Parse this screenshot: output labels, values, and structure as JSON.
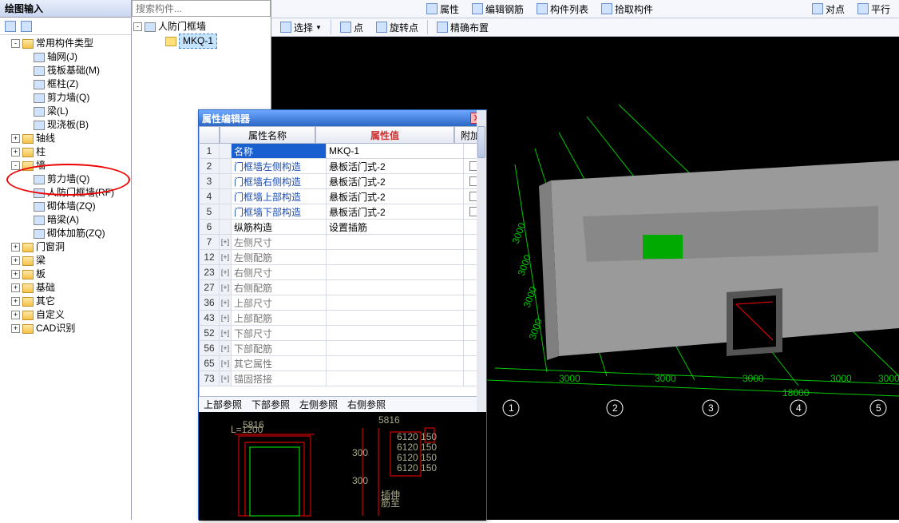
{
  "left_panel": {
    "title": "绘图输入",
    "tree": [
      {
        "level": 1,
        "exp": "-",
        "folder": true,
        "label": "常用构件类型"
      },
      {
        "level": 2,
        "icon": true,
        "label": "轴网(J)"
      },
      {
        "level": 2,
        "icon": true,
        "label": "筏板基础(M)"
      },
      {
        "level": 2,
        "icon": true,
        "label": "框柱(Z)"
      },
      {
        "level": 2,
        "icon": true,
        "label": "剪力墙(Q)"
      },
      {
        "level": 2,
        "icon": true,
        "label": "梁(L)"
      },
      {
        "level": 2,
        "icon": true,
        "label": "现浇板(B)"
      },
      {
        "level": 1,
        "exp": "+",
        "folder": true,
        "label": "轴线"
      },
      {
        "level": 1,
        "exp": "+",
        "folder": true,
        "label": "柱"
      },
      {
        "level": 1,
        "exp": "-",
        "folder": true,
        "label": "墙"
      },
      {
        "level": 2,
        "icon": true,
        "label": "剪力墙(Q)"
      },
      {
        "level": 2,
        "icon": true,
        "label": "人防门框墙(RF)"
      },
      {
        "level": 2,
        "icon": true,
        "label": "砌体墙(ZQ)"
      },
      {
        "level": 2,
        "icon": true,
        "label": "暗梁(A)"
      },
      {
        "level": 2,
        "icon": true,
        "label": "砌体加筋(ZQ)"
      },
      {
        "level": 1,
        "exp": "+",
        "folder": true,
        "label": "门窗洞"
      },
      {
        "level": 1,
        "exp": "+",
        "folder": true,
        "label": "梁"
      },
      {
        "level": 1,
        "exp": "+",
        "folder": true,
        "label": "板"
      },
      {
        "level": 1,
        "exp": "+",
        "folder": true,
        "label": "基础"
      },
      {
        "level": 1,
        "exp": "+",
        "folder": true,
        "label": "其它"
      },
      {
        "level": 1,
        "exp": "+",
        "folder": true,
        "label": "自定义"
      },
      {
        "level": 1,
        "exp": "+",
        "folder": true,
        "label": "CAD识别"
      }
    ]
  },
  "mid_panel": {
    "search_placeholder": "搜索构件...",
    "root_label": "人防门框墙",
    "item_label": "MKQ-1"
  },
  "toolbar": {
    "row1_items": [
      "属性",
      "编辑钢筋",
      "构件列表",
      "拾取构件"
    ],
    "row1_right": [
      "对点",
      "平行"
    ],
    "row2_select": "选择",
    "row2_point": "点",
    "row2_rotate": "旋转点",
    "row2_place": "精确布置"
  },
  "dialog": {
    "title": "属性编辑器",
    "col_name": "属性名称",
    "col_value": "属性值",
    "col_add": "附加",
    "rows": [
      {
        "n": "1",
        "ex": "",
        "name": "名称",
        "val": "MKQ-1",
        "chk": false,
        "sel": true,
        "blue": false
      },
      {
        "n": "2",
        "ex": "",
        "name": "门框墙左侧构造",
        "val": "悬板活门式-2",
        "chk": true,
        "blue": true
      },
      {
        "n": "3",
        "ex": "",
        "name": "门框墙右侧构造",
        "val": "悬板活门式-2",
        "chk": true,
        "blue": true
      },
      {
        "n": "4",
        "ex": "",
        "name": "门框墙上部构造",
        "val": "悬板活门式-2",
        "chk": true,
        "blue": true
      },
      {
        "n": "5",
        "ex": "",
        "name": "门框墙下部构造",
        "val": "悬板活门式-2",
        "chk": true,
        "blue": true
      },
      {
        "n": "6",
        "ex": "",
        "name": "纵筋构造",
        "val": "设置插筋",
        "chk": false,
        "blue": false
      },
      {
        "n": "7",
        "ex": "+",
        "name": "左侧尺寸",
        "val": "",
        "gray": true
      },
      {
        "n": "12",
        "ex": "+",
        "name": "左侧配筋",
        "val": "",
        "gray": true
      },
      {
        "n": "23",
        "ex": "+",
        "name": "右侧尺寸",
        "val": "",
        "gray": true
      },
      {
        "n": "27",
        "ex": "+",
        "name": "右侧配筋",
        "val": "",
        "gray": true
      },
      {
        "n": "36",
        "ex": "+",
        "name": "上部尺寸",
        "val": "",
        "gray": true
      },
      {
        "n": "43",
        "ex": "+",
        "name": "上部配筋",
        "val": "",
        "gray": true
      },
      {
        "n": "52",
        "ex": "+",
        "name": "下部尺寸",
        "val": "",
        "gray": true
      },
      {
        "n": "56",
        "ex": "+",
        "name": "下部配筋",
        "val": "",
        "gray": true
      },
      {
        "n": "65",
        "ex": "+",
        "name": "其它属性",
        "val": "",
        "gray": true
      },
      {
        "n": "73",
        "ex": "+",
        "name": "锚固搭接",
        "val": "",
        "gray": true
      }
    ],
    "footer": [
      "上部参照",
      "下部参照",
      "左侧参照",
      "右侧参照"
    ]
  },
  "viewport": {
    "axis_dims": [
      "3000",
      "3000",
      "3000",
      "3000",
      "3000",
      "3000",
      "3000",
      "3000"
    ],
    "total": "18000",
    "axis_nums": [
      "1",
      "2",
      "3",
      "4",
      "5"
    ]
  }
}
